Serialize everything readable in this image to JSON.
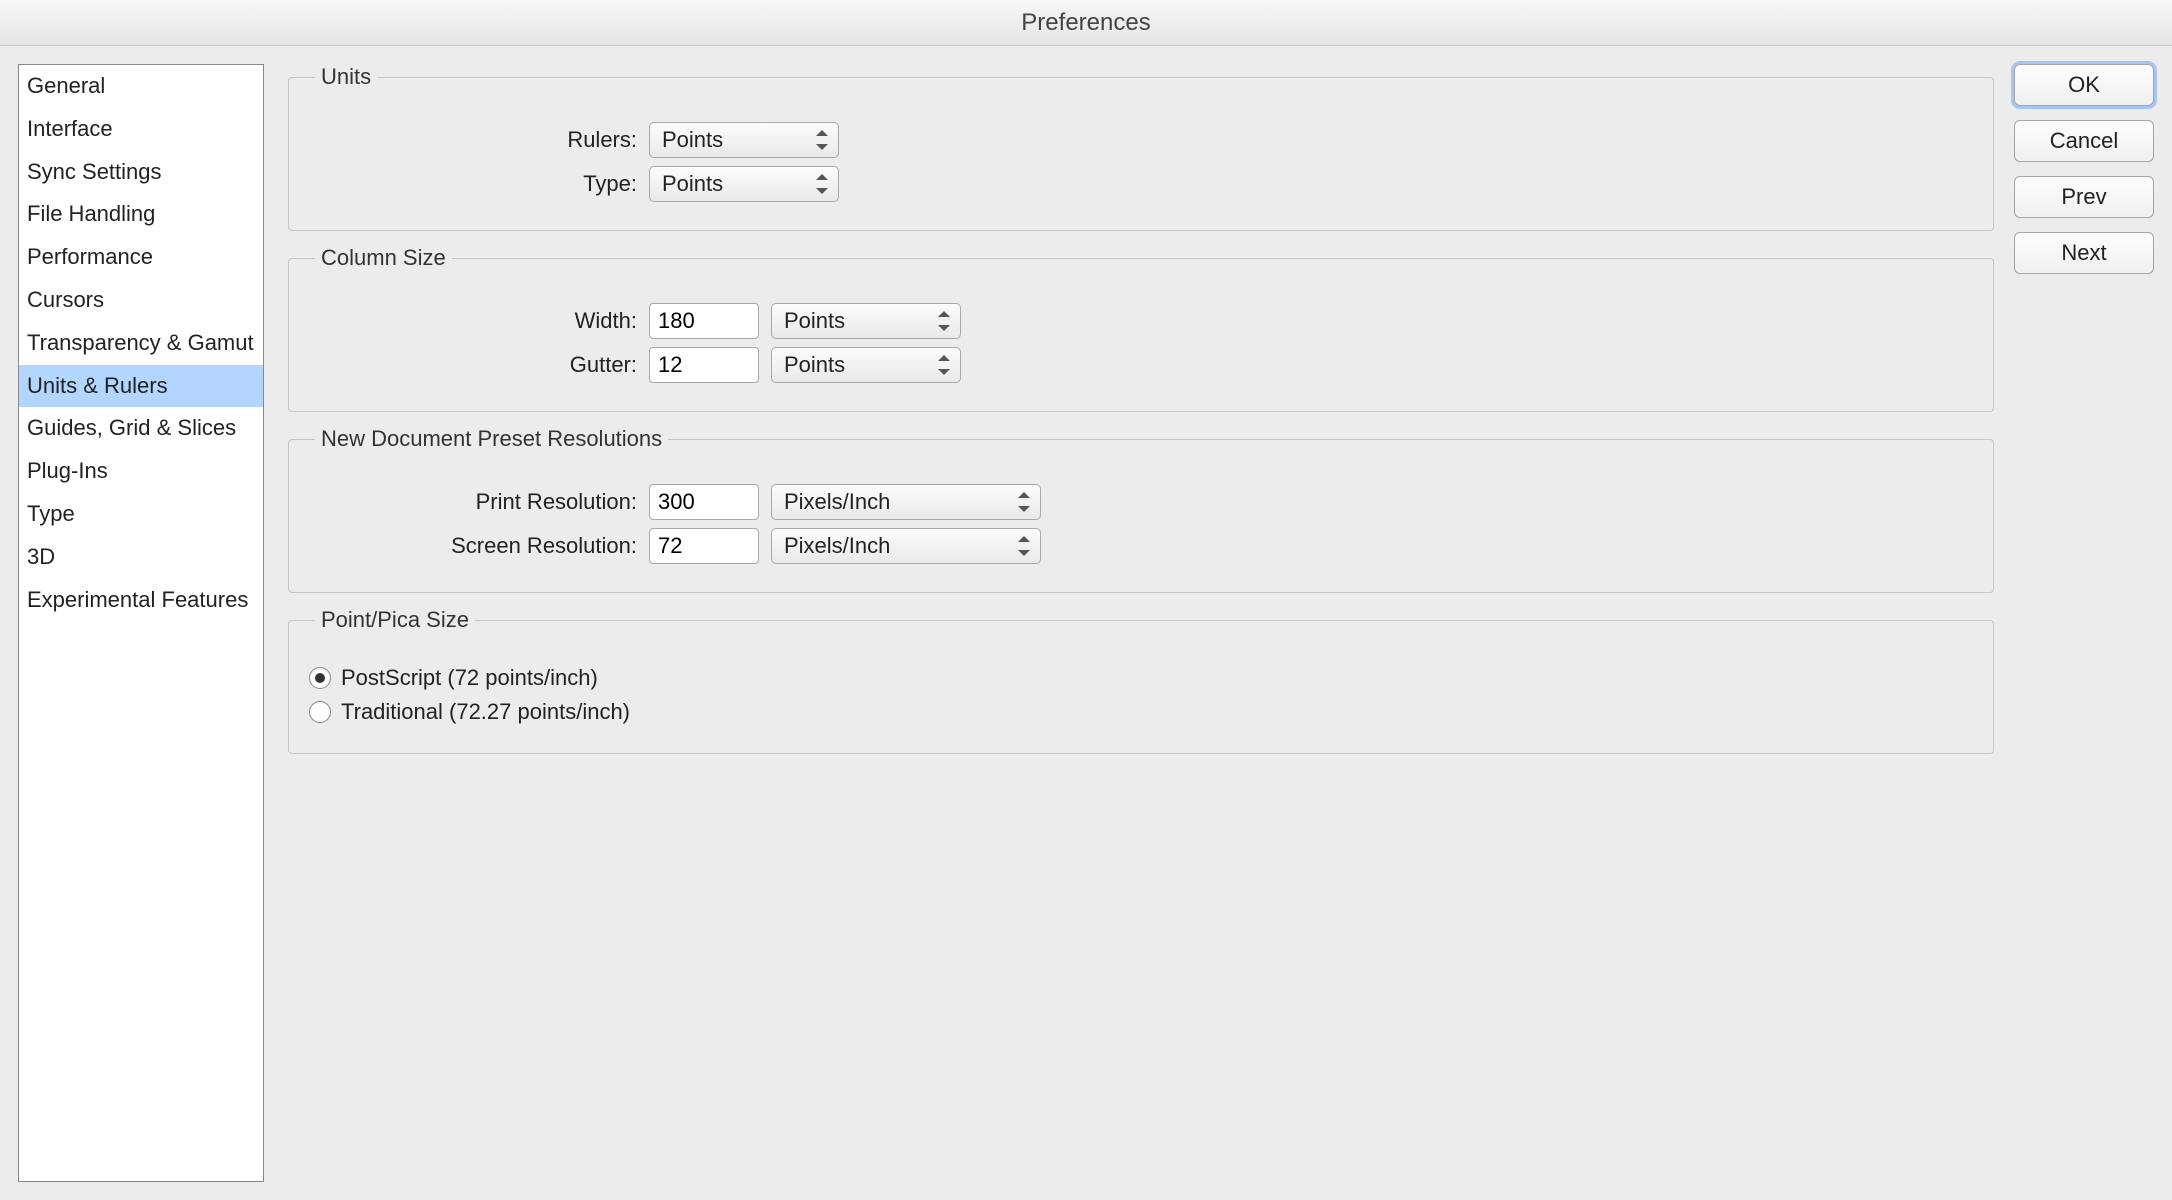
{
  "window": {
    "title": "Preferences"
  },
  "sidebar": {
    "items": [
      {
        "label": "General"
      },
      {
        "label": "Interface"
      },
      {
        "label": "Sync Settings"
      },
      {
        "label": "File Handling"
      },
      {
        "label": "Performance"
      },
      {
        "label": "Cursors"
      },
      {
        "label": "Transparency & Gamut"
      },
      {
        "label": "Units & Rulers"
      },
      {
        "label": "Guides, Grid & Slices"
      },
      {
        "label": "Plug-Ins"
      },
      {
        "label": "Type"
      },
      {
        "label": "3D"
      },
      {
        "label": "Experimental Features"
      }
    ],
    "selected_index": 7
  },
  "groups": {
    "units": {
      "legend": "Units",
      "rulers_label": "Rulers:",
      "rulers_value": "Points",
      "type_label": "Type:",
      "type_value": "Points"
    },
    "column_size": {
      "legend": "Column Size",
      "width_label": "Width:",
      "width_value": "180",
      "width_unit": "Points",
      "gutter_label": "Gutter:",
      "gutter_value": "12",
      "gutter_unit": "Points"
    },
    "resolutions": {
      "legend": "New Document Preset Resolutions",
      "print_label": "Print Resolution:",
      "print_value": "300",
      "print_unit": "Pixels/Inch",
      "screen_label": "Screen Resolution:",
      "screen_value": "72",
      "screen_unit": "Pixels/Inch"
    },
    "point_pica": {
      "legend": "Point/Pica Size",
      "postscript_label": "PostScript (72 points/inch)",
      "traditional_label": "Traditional (72.27 points/inch)",
      "selected": "postscript"
    }
  },
  "buttons": {
    "ok": "OK",
    "cancel": "Cancel",
    "prev": "Prev",
    "next": "Next"
  }
}
